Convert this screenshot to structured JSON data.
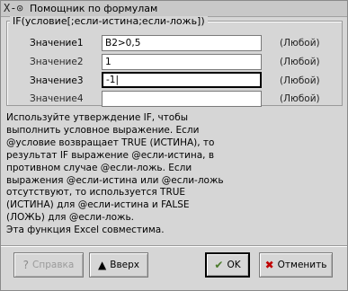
{
  "window": {
    "menu_glyph": "X‑⊙",
    "title": "Помощник по формулам"
  },
  "group": {
    "legend": "IF(условие[;если-истина;если-ложь])"
  },
  "arguments": [
    {
      "label": "Значение1",
      "value": "B2>0,5",
      "type": "(Любой)"
    },
    {
      "label": "Значение2",
      "value": "1",
      "type": "(Любой)"
    },
    {
      "label": "Значение3",
      "value": "-1|",
      "type": "(Любой)"
    },
    {
      "label": "Значение4",
      "value": "",
      "type": "(Любой)"
    }
  ],
  "help_lines": [
    "Используйте утверждение IF, чтобы",
    "выполнить условное выражение. Если",
    "@условие возвращает TRUE (ИСТИНА), то",
    "результат IF выражение @если-истина, в",
    "противном случае @если-ложь. Если",
    "выражения @если-истина или @если-ложь",
    "отсутствуют, то используется TRUE",
    "(ИСТИНА) для @если-истина и FALSE",
    "(ЛОЖЬ) для @если-ложь.",
    "Эта функция Excel совместима."
  ],
  "buttons": {
    "help": {
      "label": "Справка",
      "icon": "help-icon",
      "glyph": "?"
    },
    "up": {
      "label": "Вверх",
      "icon": "up-arrow-icon",
      "glyph": "▲"
    },
    "ok": {
      "label": "OK",
      "icon": "ok-icon",
      "glyph": "✔"
    },
    "cancel": {
      "label": "Отменить",
      "icon": "cancel-icon",
      "glyph": "✖"
    }
  },
  "colors": {
    "background": "#d6d6d6",
    "cancel_icon": "#c00000",
    "ok_icon": "#4a7a2a"
  }
}
